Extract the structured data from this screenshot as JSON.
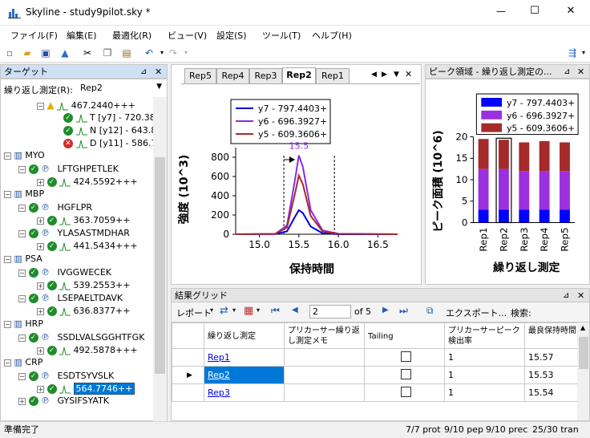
{
  "window": {
    "title": "Skyline - study9pilot.sky *",
    "minimize": "—",
    "maximize": "☐",
    "close": "✕"
  },
  "menu": [
    "ファイル(F)",
    "編集(E)",
    "最適化(R)",
    "ビュー(V)",
    "設定(S)",
    "ツール(T)",
    "ヘルプ(H)"
  ],
  "targets": {
    "title": "ターゲット",
    "pin": "⊿",
    "close": "✕",
    "replicate_label": "繰り返し測定(R):",
    "replicate_value": "Rep2",
    "tree": [
      {
        "text": "467.2440+++"
      },
      {
        "text": "T [y7] - 720.388"
      },
      {
        "text": "N [y12] - 643.82"
      },
      {
        "text": "D [y11] - 586.75"
      },
      {
        "text": "MYO"
      },
      {
        "text": "LFTGHPETLEK"
      },
      {
        "text": "424.5592+++"
      },
      {
        "text": "MBP"
      },
      {
        "text": "HGFLPR"
      },
      {
        "text": "363.7059++"
      },
      {
        "text": "YLASASTMDHAR"
      },
      {
        "text": "441.5434+++"
      },
      {
        "text": "PSA"
      },
      {
        "text": "IVGGWECEK"
      },
      {
        "text": "539.2553++"
      },
      {
        "text": "LSEPAELTDAVK"
      },
      {
        "text": "636.8377++"
      },
      {
        "text": "HRP"
      },
      {
        "text": "SSDLVALSGGHTFGK"
      },
      {
        "text": "492.5878+++"
      },
      {
        "text": "CRP"
      },
      {
        "text": "ESDTSYVSLK"
      },
      {
        "text": "564.7746++"
      },
      {
        "text": "GYSIFSYATK"
      }
    ]
  },
  "chromatogram": {
    "tabs": [
      "Rep5",
      "Rep4",
      "Rep3",
      "Rep2",
      "Rep1"
    ],
    "selected_tab": "Rep2",
    "legend": [
      "y7 - 797.4403+",
      "y6 - 696.3927+",
      "y5 - 609.3606+"
    ],
    "colors": [
      "#0000dd",
      "#8a2be2",
      "#a52a2a"
    ],
    "peak_label": "15.5",
    "xlabel": "保持時間",
    "ylabel": "強度 (10^3)",
    "xticks": [
      "15.0",
      "15.5",
      "16.0",
      "16.5"
    ],
    "yticks": [
      "0",
      "200",
      "400",
      "600",
      "800"
    ]
  },
  "peak_area": {
    "title": "ピーク領域 - 繰り返し測定の...",
    "legend": [
      "y7 - 797.4403+",
      "y6 - 696.3927+",
      "y5 - 609.3606+"
    ],
    "colors": [
      "#0000ff",
      "#9b30e0",
      "#a52a2a"
    ],
    "ylabel": "ピーク面積 (10^6)",
    "xlabel": "繰り返し測定",
    "yticks": [
      "0",
      "5",
      "10",
      "15",
      "20"
    ],
    "categories": [
      "Rep1",
      "Rep2",
      "Rep3",
      "Rep4",
      "Rep5"
    ]
  },
  "chart_data": [
    {
      "type": "line",
      "xlabel": "保持時間",
      "ylabel": "強度 (10^3)",
      "xlim": [
        14.7,
        16.75
      ],
      "ylim": [
        0,
        900
      ],
      "annotations": [
        "15.5"
      ],
      "series": [
        {
          "name": "y7 - 797.4403+",
          "x": [
            14.7,
            15.2,
            15.35,
            15.45,
            15.5,
            15.55,
            15.65,
            15.8,
            16.0,
            16.75
          ],
          "y": [
            0,
            2,
            30,
            180,
            250,
            220,
            80,
            10,
            0,
            0
          ]
        },
        {
          "name": "y6 - 696.3927+",
          "x": [
            14.7,
            15.2,
            15.35,
            15.45,
            15.5,
            15.55,
            15.65,
            15.8,
            16.0,
            16.75
          ],
          "y": [
            0,
            3,
            90,
            560,
            820,
            700,
            250,
            40,
            5,
            0
          ]
        },
        {
          "name": "y5 - 609.3606+",
          "x": [
            14.7,
            15.2,
            15.35,
            15.45,
            15.5,
            15.55,
            15.65,
            15.8,
            16.0,
            16.75
          ],
          "y": [
            0,
            3,
            70,
            420,
            610,
            520,
            190,
            30,
            4,
            0
          ]
        }
      ]
    },
    {
      "type": "bar",
      "stacked": true,
      "xlabel": "繰り返し測定",
      "ylabel": "ピーク面積 (10^6)",
      "ylim": [
        0,
        20
      ],
      "categories": [
        "Rep1",
        "Rep2",
        "Rep3",
        "Rep4",
        "Rep5"
      ],
      "series": [
        {
          "name": "y7 - 797.4403+",
          "values": [
            3.0,
            3.0,
            3.0,
            3.0,
            3.0
          ]
        },
        {
          "name": "y6 - 696.3927+",
          "values": [
            9.5,
            9.5,
            9.0,
            9.0,
            9.0
          ]
        },
        {
          "name": "y5 - 609.3606+",
          "values": [
            7.0,
            6.8,
            6.7,
            7.0,
            6.7
          ]
        }
      ]
    }
  ],
  "results": {
    "title": "結果グリッド",
    "report": "レポート",
    "page": "2",
    "of": "of 5",
    "export": "エクスポート...",
    "search": "検索:",
    "headers": [
      "繰り返し測定",
      "プリカーサー繰り返し測定メモ",
      "Tailing",
      "プリカーサーピーク検出率",
      "最良保持時間"
    ],
    "rows": [
      {
        "rep": "Rep1",
        "rate": "1",
        "rt": "15.57"
      },
      {
        "rep": "Rep2",
        "rate": "1",
        "rt": "15.53"
      },
      {
        "rep": "Rep3",
        "rate": "1",
        "rt": "15.54"
      }
    ]
  },
  "status": {
    "ready": "準備完了",
    "prot": "7/7 prot",
    "pep": "9/10 pep",
    "prec": "9/10 prec",
    "tran": "25/30 tran"
  }
}
